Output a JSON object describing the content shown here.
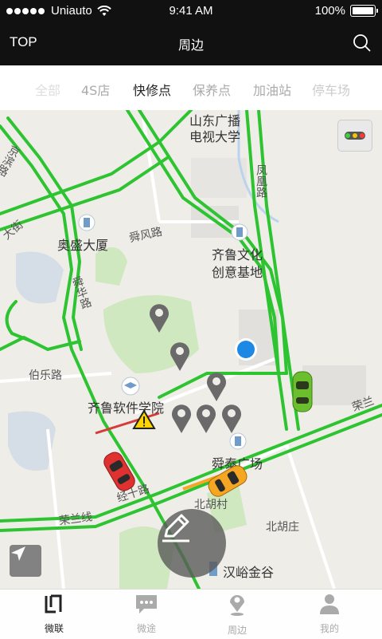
{
  "status_bar": {
    "carrier": "Uniauto",
    "time": "9:41 AM",
    "battery": "100%"
  },
  "header": {
    "left_label": "TOP",
    "title": "周边"
  },
  "tabs": [
    {
      "label": "全部"
    },
    {
      "label": "4S店"
    },
    {
      "label": "快修点"
    },
    {
      "label": "保养点"
    },
    {
      "label": "加油站"
    },
    {
      "label": "停车场"
    }
  ],
  "active_tab": "快修点",
  "map": {
    "labels": {
      "shandong_tv_1": "山东广播",
      "shandong_tv_2": "电视大学",
      "fenghuang_road": "凤凰路",
      "aosheng": "奥盛大厦",
      "shunfeng_road": "舜风路",
      "qilu_culture_1": "齐鲁文化",
      "qilu_culture_2": "创意基地",
      "shunhua_road": "舜华路",
      "bole_road": "伯乐路",
      "qilu_software": "齐鲁软件学院",
      "shuntai": "舜泰广场",
      "beihu_village": "北胡村",
      "beihuzhuang": "北胡庄",
      "rongwu_line": "荣兰线",
      "jingshi_road": "经十路",
      "hanyu": "汉峪金谷",
      "rong_right": "荣兰",
      "left_edge_1": "京滨路",
      "left_edge_2": "大街"
    }
  },
  "tab_bar": [
    {
      "label": "微联",
      "icon": "weilian-logo-icon"
    },
    {
      "label": "微途",
      "icon": "chat-icon"
    },
    {
      "label": "周边",
      "icon": "location-pin-icon"
    },
    {
      "label": "我的",
      "icon": "user-icon"
    }
  ],
  "colors": {
    "road_green": "#2ec431",
    "header_bg": "#111111",
    "pin_gray": "#6a6a6a",
    "location_blue": "#1e88e5"
  }
}
